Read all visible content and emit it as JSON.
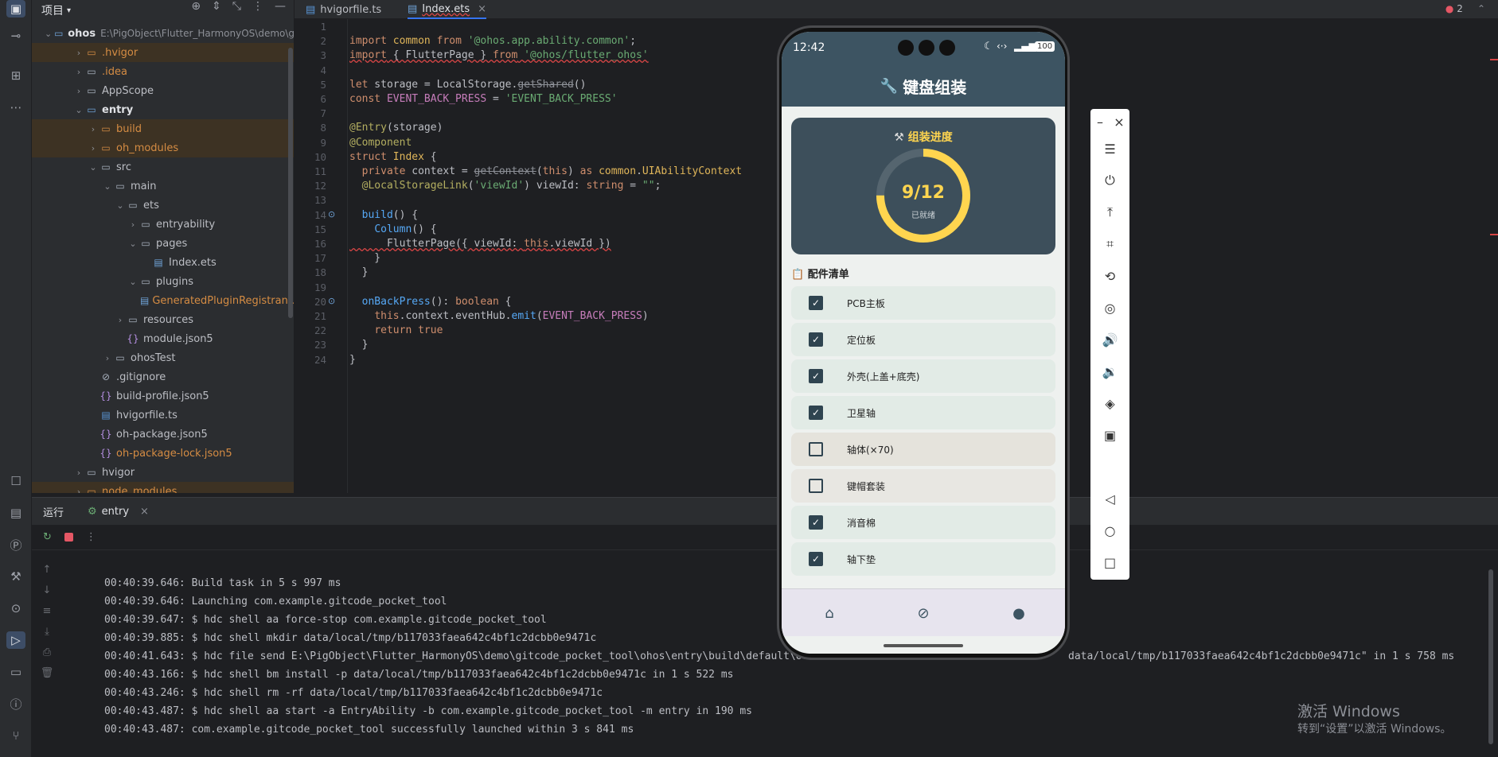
{
  "project_panel": {
    "title": "项目",
    "root_name": "ohos",
    "root_path": "E:\\PigObject\\Flutter_HarmonyOS\\demo\\g",
    "tree": [
      {
        "label": ".hvigor",
        "depth": 1,
        "kind": "folder",
        "expanded": false,
        "highlight": true,
        "color": "orange"
      },
      {
        "label": ".idea",
        "depth": 1,
        "kind": "folder",
        "expanded": false,
        "color": "orange"
      },
      {
        "label": "AppScope",
        "depth": 1,
        "kind": "folder",
        "expanded": false
      },
      {
        "label": "entry",
        "depth": 1,
        "kind": "module",
        "expanded": true,
        "bold": true
      },
      {
        "label": "build",
        "depth": 2,
        "kind": "folder",
        "expanded": false,
        "highlight": true,
        "color": "orange"
      },
      {
        "label": "oh_modules",
        "depth": 2,
        "kind": "folder",
        "expanded": false,
        "highlight": true,
        "color": "orange"
      },
      {
        "label": "src",
        "depth": 2,
        "kind": "folder",
        "expanded": true
      },
      {
        "label": "main",
        "depth": 3,
        "kind": "folder",
        "expanded": true
      },
      {
        "label": "ets",
        "depth": 4,
        "kind": "folder",
        "expanded": true
      },
      {
        "label": "entryability",
        "depth": 5,
        "kind": "folder",
        "expanded": false
      },
      {
        "label": "pages",
        "depth": 5,
        "kind": "folder",
        "expanded": true
      },
      {
        "label": "Index.ets",
        "depth": 6,
        "kind": "file"
      },
      {
        "label": "plugins",
        "depth": 5,
        "kind": "folder",
        "expanded": true
      },
      {
        "label": "GeneratedPluginRegistrant.e",
        "depth": 6,
        "kind": "file",
        "color": "orange"
      },
      {
        "label": "resources",
        "depth": 4,
        "kind": "folder",
        "expanded": false
      },
      {
        "label": "module.json5",
        "depth": 4,
        "kind": "json"
      },
      {
        "label": "ohosTest",
        "depth": 3,
        "kind": "folder",
        "expanded": false
      },
      {
        "label": ".gitignore",
        "depth": 2,
        "kind": "ignore"
      },
      {
        "label": "build-profile.json5",
        "depth": 2,
        "kind": "json"
      },
      {
        "label": "hvigorfile.ts",
        "depth": 2,
        "kind": "ts"
      },
      {
        "label": "oh-package.json5",
        "depth": 2,
        "kind": "json"
      },
      {
        "label": "oh-package-lock.json5",
        "depth": 2,
        "kind": "json",
        "color": "orange"
      },
      {
        "label": "hvigor",
        "depth": 1,
        "kind": "folder",
        "expanded": false
      },
      {
        "label": "node_modules",
        "depth": 1,
        "kind": "folder",
        "expanded": false,
        "highlight": true,
        "color": "orange"
      }
    ]
  },
  "editor": {
    "tabs": [
      {
        "label": "hvigorfile.ts",
        "active": false
      },
      {
        "label": "Index.ets",
        "active": true
      }
    ],
    "problems_count": "2",
    "lines": [
      "",
      "import common from '@ohos.app.ability.common';",
      "import { FlutterPage } from '@ohos/flutter_ohos'",
      "",
      "let storage = LocalStorage.getShared()",
      "const EVENT_BACK_PRESS = 'EVENT_BACK_PRESS'",
      "",
      "@Entry(storage)",
      "@Component",
      "struct Index {",
      "  private context = getContext(this) as common.UIAbilityContext",
      "  @LocalStorageLink('viewId') viewId: string = \"\";",
      "",
      "  build() {",
      "    Column() {",
      "      FlutterPage({ viewId: this.viewId })",
      "    }",
      "  }",
      "",
      "  onBackPress(): boolean {",
      "    this.context.eventHub.emit(EVENT_BACK_PRESS)",
      "    return true",
      "  }",
      "}"
    ]
  },
  "run_panel": {
    "title": "运行",
    "tab_label": "entry",
    "log": [
      "00:40:39.646: Build task in 5 s 997 ms",
      "00:40:39.646: Launching com.example.gitcode_pocket_tool",
      "00:40:39.647: $ hdc shell aa force-stop com.example.gitcode_pocket_tool",
      "00:40:39.885: $ hdc shell mkdir data/local/tmp/b117033faea642c4bf1c2dcbb0e9471c",
      "00:40:41.643: $ hdc file send E:\\PigObject\\Flutter_HarmonyOS\\demo\\gitcode_pocket_tool\\ohos\\entry\\build\\default\\ou",
      "00:40:43.166: $ hdc shell bm install -p data/local/tmp/b117033faea642c4bf1c2dcbb0e9471c in 1 s 522 ms",
      "00:40:43.246: $ hdc shell rm -rf data/local/tmp/b117033faea642c4bf1c2dcbb0e9471c",
      "00:40:43.487: $ hdc shell aa start -a EntryAbility -b com.example.gitcode_pocket_tool -m entry in 190 ms",
      "00:40:43.487: com.example.gitcode_pocket_tool successfully launched within 3 s 841 ms"
    ],
    "log_tail_right": "data/local/tmp/b117033faea642c4bf1c2dcbb0e9471c\" in 1 s 758 ms"
  },
  "phone": {
    "time": "12:42",
    "battery": "100",
    "app_title": "键盘组装",
    "progress_title": "组装进度",
    "progress_value": "9/12",
    "progress_fraction": 0.75,
    "progress_caption": "已就绪",
    "parts_title": "配件清单",
    "parts": [
      {
        "label": "PCB主板",
        "checked": true
      },
      {
        "label": "定位板",
        "checked": true
      },
      {
        "label": "外壳(上盖+底壳)",
        "checked": true
      },
      {
        "label": "卫星轴",
        "checked": true
      },
      {
        "label": "轴体(×70)",
        "checked": false
      },
      {
        "label": "键帽套装",
        "checked": false
      },
      {
        "label": "消音棉",
        "checked": true
      },
      {
        "label": "轴下垫",
        "checked": true
      }
    ],
    "nav": [
      "home-icon",
      "explore-icon",
      "person-icon"
    ],
    "colors": {
      "appbar": "#3d5462",
      "ring": "#ffd54f",
      "card": "#3d4f5b"
    }
  },
  "watermark": {
    "line1": "激活 Windows",
    "line2": "转到“设置”以激活 Windows。"
  }
}
